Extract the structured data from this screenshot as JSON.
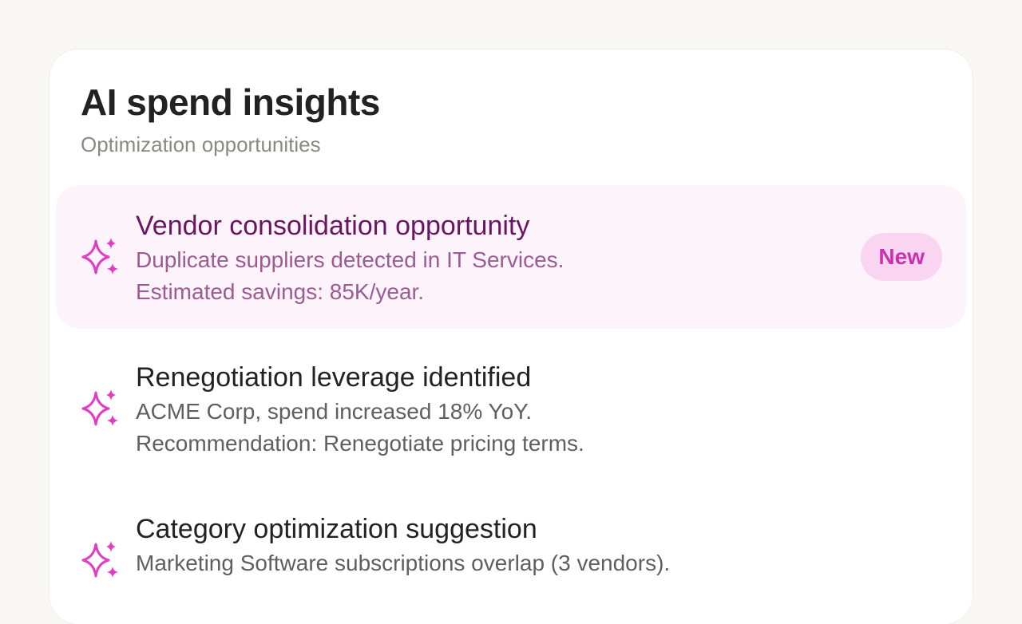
{
  "header": {
    "title": "AI spend insights",
    "subtitle": "Optimization opportunities"
  },
  "colors": {
    "accent": "#e23bc4",
    "highlight_bg": "#fcf3fb",
    "badge_bg": "#f9d5f2",
    "badge_text": "#c932ad"
  },
  "insights": [
    {
      "icon": "sparkles-icon",
      "title": "Vendor consolidation opportunity",
      "line1": "Duplicate suppliers detected in IT Services.",
      "line2": "Estimated savings: 85K/year.",
      "badge": "New"
    },
    {
      "icon": "sparkles-icon",
      "title": "Renegotiation leverage identified",
      "line1": "ACME Corp, spend increased 18% YoY.",
      "line2": "Recommendation: Renegotiate pricing terms."
    },
    {
      "icon": "sparkles-icon",
      "title": "Category optimization suggestion",
      "line1": "Marketing Software subscriptions overlap (3 vendors)."
    }
  ]
}
